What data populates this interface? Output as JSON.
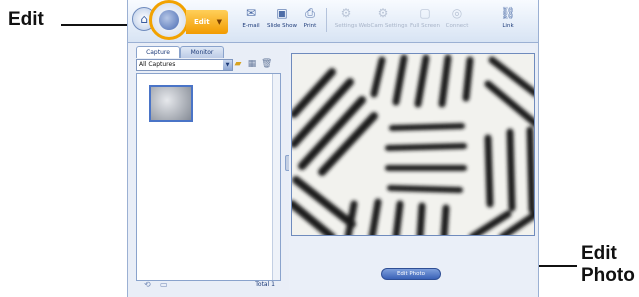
{
  "callouts": {
    "edit": "Edit",
    "edit_photo_line1": "Edit",
    "edit_photo_line2": "Photo"
  },
  "toolbar": {
    "edit_label": "Edit",
    "tools": [
      {
        "label": "E-mail",
        "icon": "email-icon",
        "enabled": true
      },
      {
        "label": "Slide Show",
        "icon": "slideshow-icon",
        "enabled": true
      },
      {
        "label": "Print",
        "icon": "print-icon",
        "enabled": true
      },
      {
        "label": "Settings",
        "icon": "settings-icon",
        "enabled": false
      },
      {
        "label": "WebCam Settings",
        "icon": "webcam-settings-icon",
        "enabled": false
      },
      {
        "label": "Full Screen",
        "icon": "full-screen-icon",
        "enabled": false
      },
      {
        "label": "Connect",
        "icon": "connect-icon",
        "enabled": false
      },
      {
        "label": "Link",
        "icon": "link-icon",
        "enabled": true
      }
    ]
  },
  "left_pane": {
    "tabs": [
      "Capture",
      "Monitor"
    ],
    "filter_value": "All Captures",
    "total_label": "Total 1"
  },
  "right_pane": {
    "edit_photo_label": "Edit Photo"
  },
  "colors": {
    "accent_orange": "#f29b00",
    "toolbar_blue": "#1c3a78",
    "button_blue": "#3a62b7"
  }
}
